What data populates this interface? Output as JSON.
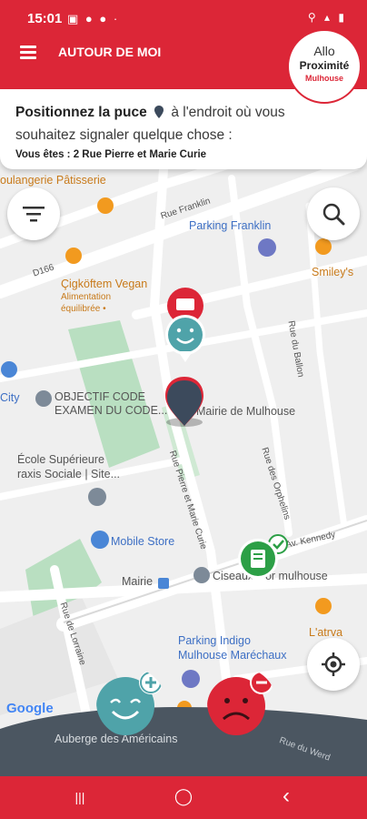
{
  "status_bar": {
    "time": "15:01",
    "notifications": "▣ ● ● ·",
    "system": "⚲ ▴ ▮"
  },
  "app_bar": {
    "title": "AUTOUR DE MOI",
    "menu_icon": "hamburger-icon"
  },
  "logo": {
    "line1": "Allo",
    "line2": "Proximité",
    "line3": "Mulhouse"
  },
  "instruction": {
    "bold_text": "Positionnez la puce",
    "rest_text": "à l'endroit où vous",
    "second_line": "souhaitez signaler quelque chose :",
    "address": "Vous êtes : 2 Rue Pierre et Marie Curie"
  },
  "map_labels": {
    "bakery": "oulangerie Pâtisserie",
    "rue_franklin": "Rue Franklin",
    "parking_franklin": "Parking Franklin",
    "smileys": "Smiley's",
    "d166": "D166",
    "cigkoftem": "Çigköftem Vegan",
    "cigkoftem_sub1": "Alimentation",
    "cigkoftem_sub2": "équilibrée •",
    "rue_ballon": "Rue du Ballon",
    "city": "City",
    "objectif1": "OBJECTIF CODE",
    "objectif2": "EXAMEN DU CODE...",
    "mairie_mulhouse": "Mairie de Mulhouse",
    "ecole1": "École Supérieure",
    "ecole2": "raxis Sociale | Site...",
    "rue_pierre": "Rue Pierre et Marie Curie",
    "rue_orphelins": "Rue des Orphelins",
    "mobile_store": "Mobile Store",
    "kennedy": "Av. Kennedy",
    "mairie_stop": "Mairie",
    "ciseaux": "Ciseaux d'or mulhouse",
    "rue_lorraine": "Rue de Lorraine",
    "parking_indigo1": "Parking Indigo",
    "parking_indigo2": "Mulhouse Maréchaux",
    "latrva": "L'atrva",
    "auberge": "Auberge des Américains",
    "rue_mulhouse": "Rue du Werd",
    "google": "Google"
  },
  "buttons": {
    "filter": "filter-icon",
    "search": "search-icon",
    "locate": "locate-icon",
    "happy_add": "happy-face-plus",
    "sad_add": "sad-face-minus"
  },
  "colors": {
    "brand_red": "#dc2637",
    "teal": "#4fa3a9",
    "dark_pin": "#3c4a5c",
    "bottom_slate": "#4b5661",
    "park_green": "#b9dfc1"
  },
  "navbar": {
    "recent": "|||",
    "home": "◯",
    "back": "‹"
  }
}
